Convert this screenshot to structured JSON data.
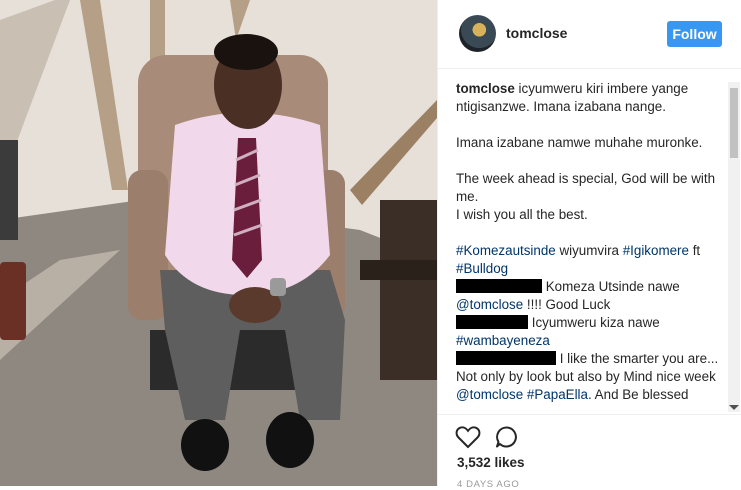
{
  "post": {
    "author": "tomclose",
    "follow_label": "Follow"
  },
  "caption": {
    "username": "tomclose",
    "line1": " icyumweru kiri imbere yange ntigisanzwe. Imana izabana nange.",
    "line2": "Imana izabane namwe muhahe muronke.",
    "line3": "The week ahead is special, God will be with me.",
    "line4": "I wish you all the best.",
    "tags": [
      {
        "tag": "#Komezautsinde",
        "after": " wiyumvira "
      },
      {
        "tag": "#Igikomere",
        "after": " ft "
      },
      {
        "tag": "#Bulldog",
        "after": ""
      }
    ]
  },
  "comments": [
    {
      "text": " Komeza Utsinde nawe ",
      "mention": "@tomclose",
      "after": " !!!! Good Luck"
    },
    {
      "text": " Icyumweru kiza nawe ",
      "tag": "#wambayeneza"
    },
    {
      "text": " I like the smarter you are... Not only by look but also by Mind nice week ",
      "mention": "@tomclose",
      "tag": "#PapaElla",
      "after": ". And Be blessed"
    }
  ],
  "footer": {
    "likes": "3,532 likes",
    "time_ago": "4 DAYS AGO"
  },
  "icons": {
    "like": "heart-icon",
    "comment": "comment-icon",
    "avatar": "avatar"
  },
  "colors": {
    "follow_bg": "#3897f0",
    "link": "#003569",
    "border": "#efefef"
  }
}
